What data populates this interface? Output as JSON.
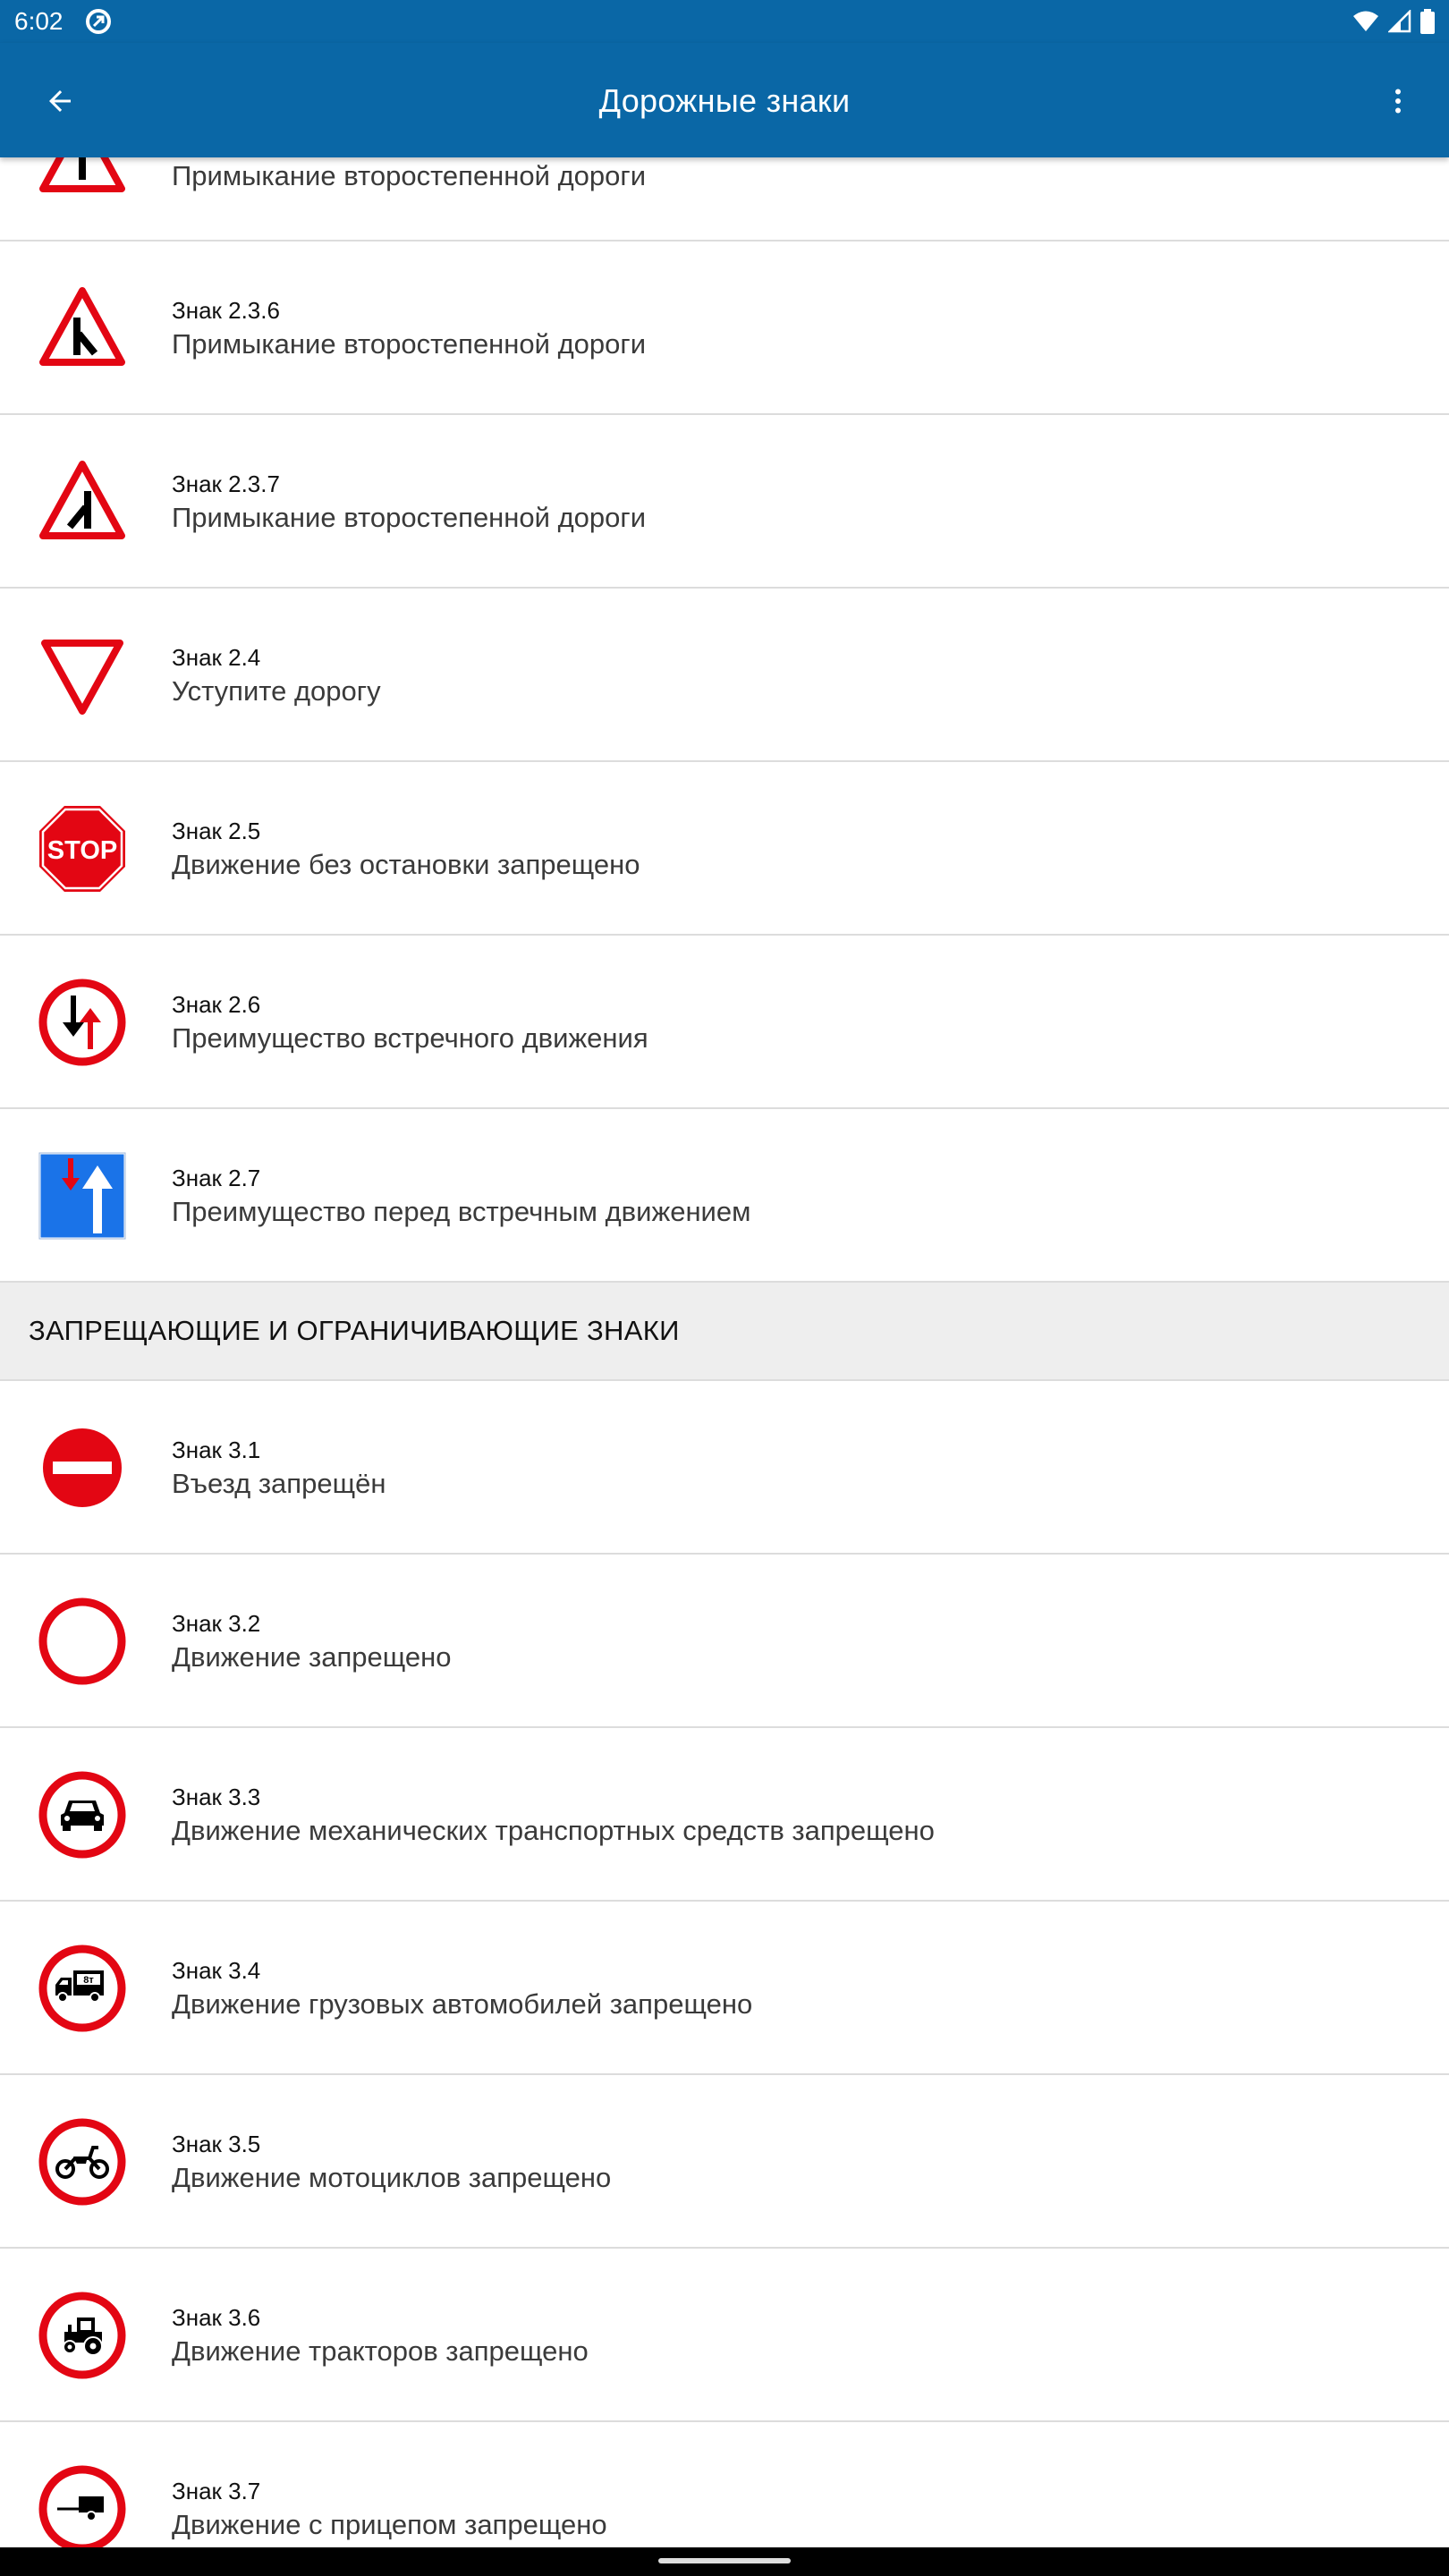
{
  "status_bar": {
    "time": "6:02"
  },
  "app_bar": {
    "title": "Дорожные знаки"
  },
  "partial_row": {
    "description": "Примыкание второстепенной дороги"
  },
  "signs": [
    {
      "title": "Знак 2.3.6",
      "description": "Примыкание второстепенной дороги",
      "icon": "warning-side-road-right-icon"
    },
    {
      "title": "Знак 2.3.7",
      "description": "Примыкание второстепенной дороги",
      "icon": "warning-side-road-left-icon"
    },
    {
      "title": "Знак 2.4",
      "description": "Уступите дорогу",
      "icon": "yield-sign-icon"
    },
    {
      "title": "Знак 2.5",
      "description": "Движение без остановки запрещено",
      "icon": "stop-sign-icon"
    },
    {
      "title": "Знак 2.6",
      "description": "Преимущество встречного движения",
      "icon": "oncoming-priority-icon"
    },
    {
      "title": "Знак 2.7",
      "description": "Преимущество перед встречным движением",
      "icon": "priority-over-oncoming-icon"
    }
  ],
  "section": {
    "title": "ЗАПРЕЩАЮЩИЕ И ОГРАНИЧИВАЮЩИЕ ЗНАКИ"
  },
  "prohibitory_signs": [
    {
      "title": "Знак 3.1",
      "description": "Въезд запрещён",
      "icon": "no-entry-icon"
    },
    {
      "title": "Знак 3.2",
      "description": "Движение запрещено",
      "icon": "no-vehicles-icon"
    },
    {
      "title": "Знак 3.3",
      "description": "Движение механических транспортных средств запрещено",
      "icon": "no-motor-vehicles-icon"
    },
    {
      "title": "Знак 3.4",
      "description": "Движение грузовых автомобилей запрещено",
      "icon": "no-trucks-icon",
      "truck_label": "8т"
    },
    {
      "title": "Знак 3.5",
      "description": "Движение мотоциклов запрещено",
      "icon": "no-motorcycles-icon"
    },
    {
      "title": "Знак 3.6",
      "description": "Движение тракторов запрещено",
      "icon": "no-tractors-icon"
    },
    {
      "title": "Знак 3.7",
      "description": "Движение с прицепом запрещено",
      "icon": "no-trailers-icon"
    }
  ],
  "colors": {
    "app_bar": "#0a67a6",
    "sign_red": "#e30613",
    "sign_blue": "#1a73e8"
  }
}
